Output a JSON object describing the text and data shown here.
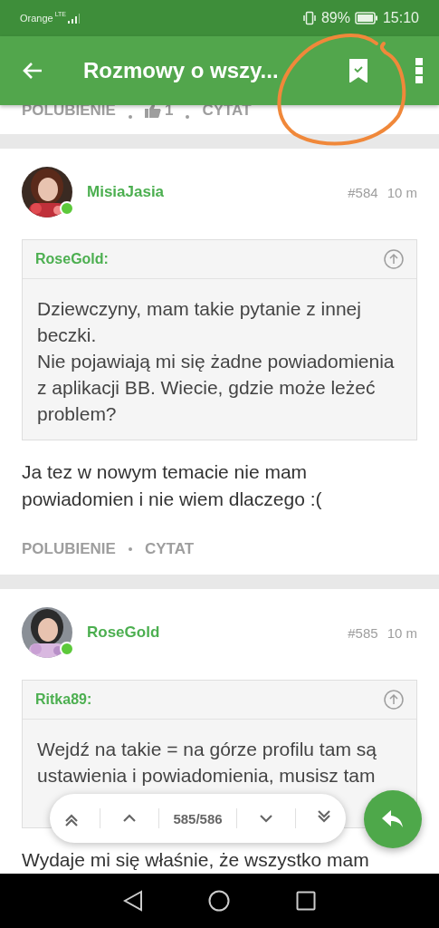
{
  "status_bar": {
    "carrier": "Orange",
    "network": "LTE",
    "battery": "89%",
    "time": "15:10"
  },
  "app_bar": {
    "title": "Rozmowy o wszy...",
    "bookmarked": true
  },
  "previous_post_actions": {
    "like": "POLUBIENIE",
    "likes": "1",
    "quote": "CYTAT"
  },
  "posts": [
    {
      "author": "MisiaJasia",
      "online": true,
      "number": "#584",
      "time": "10 m",
      "quote": {
        "author": "RoseGold:",
        "text": "Dziewczyny, mam takie pytanie z innej beczki.\nNie pojawiają mi się żadne powiadomienia z aplikacji BB. Wiecie, gdzie może leżeć problem?"
      },
      "body": "Ja tez w nowym temacie nie mam powiadomien i nie wiem dlaczego :(",
      "actions": {
        "like": "POLUBIENIE",
        "quote": "CYTAT"
      }
    },
    {
      "author": "RoseGold",
      "online": true,
      "number": "#585",
      "time": "10 m",
      "quote": {
        "author": "Ritka89:",
        "text": "Wejdź na takie = na górze profilu tam są ustawienia i powiadomienia, musisz tam"
      },
      "body": "Wydaje mi się właśnie, że wszystko mam"
    }
  ],
  "navigator": {
    "counter": "585/586"
  }
}
